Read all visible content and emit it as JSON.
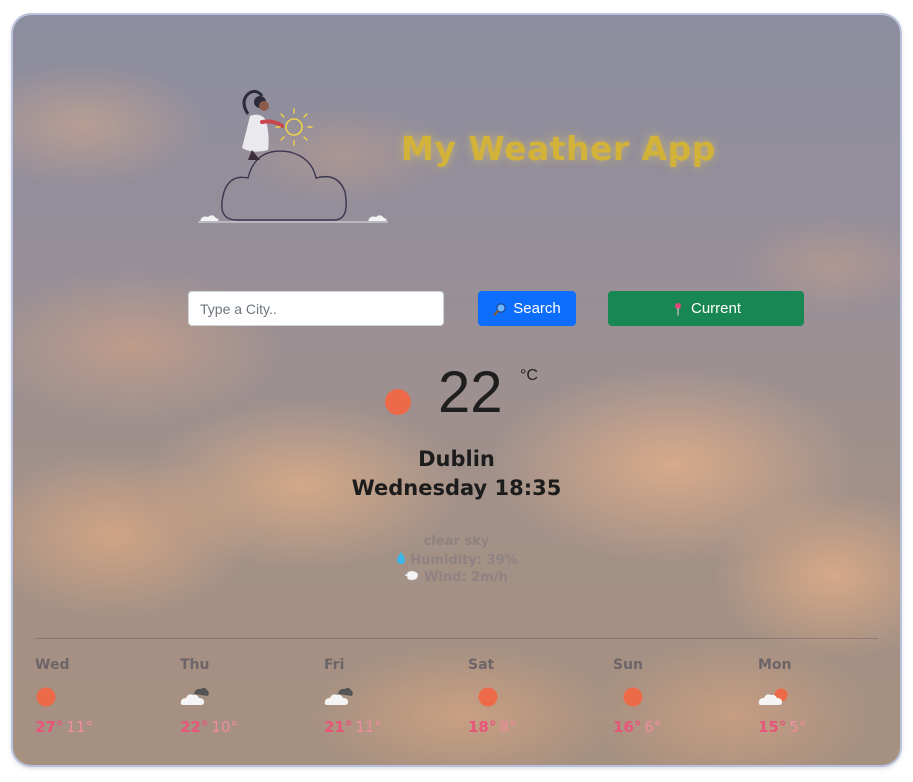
{
  "app": {
    "title": "My Weather App"
  },
  "search": {
    "placeholder": "Type a City..",
    "value": "",
    "search_label": "Search",
    "current_label": "Current"
  },
  "current": {
    "temperature": "22",
    "unit": "°C",
    "city": "Dublin",
    "datetime": "Wednesday 18:35",
    "description": "clear sky",
    "humidity": "Humidity: 39%",
    "wind": "Wind: 2m/h",
    "icon": "sun-icon"
  },
  "forecast": [
    {
      "day": "Wed",
      "icon": "sun-icon",
      "max": "27°",
      "min": "11°"
    },
    {
      "day": "Thu",
      "icon": "broken-clouds-icon",
      "max": "22°",
      "min": "10°"
    },
    {
      "day": "Fri",
      "icon": "broken-clouds-icon",
      "max": "21°",
      "min": "11°"
    },
    {
      "day": "Sat",
      "icon": "sun-icon",
      "max": "18°",
      "min": "8°"
    },
    {
      "day": "Sun",
      "icon": "sun-icon",
      "max": "16°",
      "min": "6°"
    },
    {
      "day": "Mon",
      "icon": "few-clouds-icon",
      "max": "15°",
      "min": "5°"
    }
  ],
  "colors": {
    "title": "#d3b23a",
    "search_button": "#0d6efd",
    "current_button": "#198754",
    "sun": "#ec6a48",
    "temp_max": "#e8547a",
    "temp_min": "#f08c9f"
  }
}
